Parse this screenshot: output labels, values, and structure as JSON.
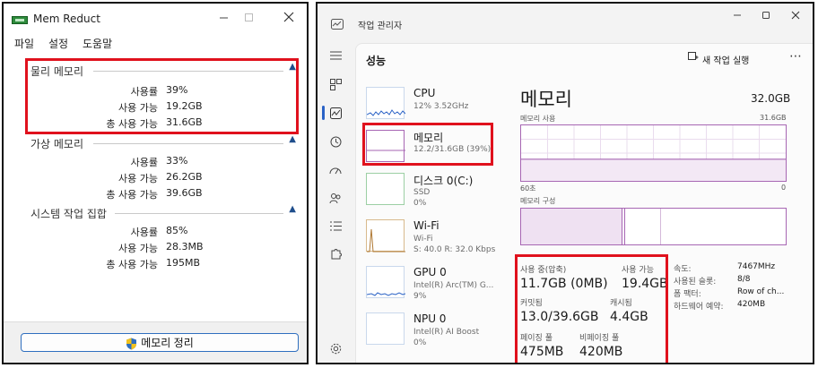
{
  "memreduct": {
    "title": "Mem Reduct",
    "menu": [
      "파일",
      "설정",
      "도움말"
    ],
    "groups": [
      {
        "title": "물리 메모리",
        "rows": [
          {
            "label": "사용률",
            "value": "39%"
          },
          {
            "label": "사용 가능",
            "value": "19.2GB"
          },
          {
            "label": "총 사용 가능",
            "value": "31.6GB"
          }
        ]
      },
      {
        "title": "가상 메모리",
        "rows": [
          {
            "label": "사용률",
            "value": "33%"
          },
          {
            "label": "사용 가능",
            "value": "26.2GB"
          },
          {
            "label": "총 사용 가능",
            "value": "39.6GB"
          }
        ]
      },
      {
        "title": "시스템 작업 집합",
        "rows": [
          {
            "label": "사용률",
            "value": "85%"
          },
          {
            "label": "사용 가능",
            "value": "28.3MB"
          },
          {
            "label": "총 사용 가능",
            "value": "195MB"
          }
        ]
      }
    ],
    "clean_button": "메모리 정리"
  },
  "taskmgr": {
    "title": "작업 관리자",
    "section_title": "성능",
    "new_task": "새 작업 실행",
    "items": [
      {
        "name": "CPU",
        "sub": "12% 3.52GHz",
        "sub2": ""
      },
      {
        "name": "메모리",
        "sub": "12.2/31.6GB (39%)",
        "sub2": ""
      },
      {
        "name": "디스크 0(C:)",
        "sub": "SSD",
        "sub2": "0%"
      },
      {
        "name": "Wi-Fi",
        "sub": "Wi-Fi",
        "sub2": "S: 40.0  R: 32.0 Kbps"
      },
      {
        "name": "GPU 0",
        "sub": "Intel(R) Arc(TM) G...",
        "sub2": "9%"
      },
      {
        "name": "NPU 0",
        "sub": "Intel(R) AI Boost",
        "sub2": "0%"
      }
    ],
    "memory": {
      "heading": "메모리",
      "total": "32.0GB",
      "usage_label": "메모리 사용",
      "usage_max": "31.6GB",
      "usage_fraction": 0.39,
      "axis_left": "60초",
      "axis_right": "0",
      "composition_label": "메모리 구성",
      "in_use_label": "사용 중(압축)",
      "in_use_value": "11.7GB (0MB)",
      "available_label": "사용 가능",
      "available_value": "19.4GB",
      "committed_label": "커밋됨",
      "committed_value": "13.0/39.6GB",
      "cached_label": "캐시됨",
      "cached_value": "4.4GB",
      "paged_label": "페이징 풀",
      "paged_value": "475MB",
      "nonpaged_label": "비페이징 풀",
      "nonpaged_value": "420MB",
      "speed_label": "속도:",
      "speed_value": "7467MHz",
      "slots_label": "사용된 슬롯:",
      "slots_value": "8/8",
      "form_label": "폼 팩터:",
      "form_value": "Row of ch...",
      "reserved_label": "하드웨어 예약:",
      "reserved_value": "420MB"
    }
  },
  "colors": {
    "highlight_red": "#e0111d",
    "memory_purple": "#a766b3",
    "accent_blue": "#2a62c6"
  }
}
